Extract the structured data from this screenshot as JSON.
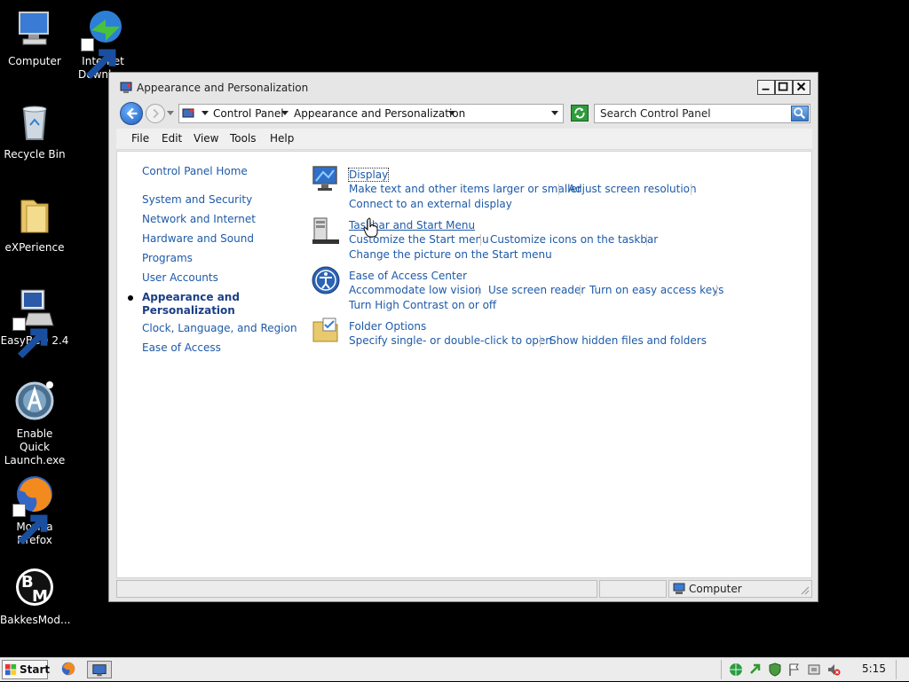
{
  "desktop": {
    "icons": [
      {
        "label": "Computer",
        "icon": "computer-icon"
      },
      {
        "label": "Internet Downlo...",
        "icon": "internet-download-manager-icon"
      },
      {
        "label": "Recycle Bin",
        "icon": "recycle-bin-icon"
      },
      {
        "label": "eXPerience",
        "icon": "folder-icon"
      },
      {
        "label": "EasyBCD 2.4",
        "icon": "easybcd-icon"
      },
      {
        "label": "Enable Quick Launch.exe",
        "icon": "quick-launch-icon"
      },
      {
        "label": "Mozilla Firefox",
        "icon": "firefox-icon"
      },
      {
        "label": "BakkesMod...",
        "icon": "bakkesmod-icon"
      }
    ]
  },
  "window": {
    "title": "Appearance and Personalization",
    "breadcrumbs": [
      "Control Panel",
      "Appearance and Personalization"
    ],
    "search_placeholder": "Search Control Panel",
    "menu": [
      "File",
      "Edit",
      "View",
      "Tools",
      "Help"
    ],
    "sidebar": {
      "home": "Control Panel Home",
      "items": [
        "System and Security",
        "Network and Internet",
        "Hardware and Sound",
        "Programs",
        "User Accounts",
        "Appearance and Personalization",
        "Clock, Language, and Region",
        "Ease of Access"
      ],
      "active_index": 5
    },
    "categories": [
      {
        "title": "Display",
        "icon": "display-monitor-icon",
        "links": [
          "Make text and other items larger or smaller",
          "Adjust screen resolution",
          "Connect to an external display"
        ]
      },
      {
        "title": "Taskbar and Start Menu",
        "icon": "taskbar-start-menu-icon",
        "links": [
          "Customize the Start menu",
          "Customize icons on the taskbar",
          "Change the picture on the Start menu"
        ]
      },
      {
        "title": "Ease of Access Center",
        "icon": "ease-of-access-icon",
        "links": [
          "Accommodate low vision",
          "Use screen reader",
          "Turn on easy access keys",
          "Turn High Contrast on or off"
        ]
      },
      {
        "title": "Folder Options",
        "icon": "folder-options-icon",
        "links": [
          "Specify single- or double-click to open",
          "Show hidden files and folders"
        ]
      }
    ],
    "status": {
      "zone": "Computer"
    }
  },
  "taskbar": {
    "start_label": "Start",
    "clock": "5:15"
  }
}
